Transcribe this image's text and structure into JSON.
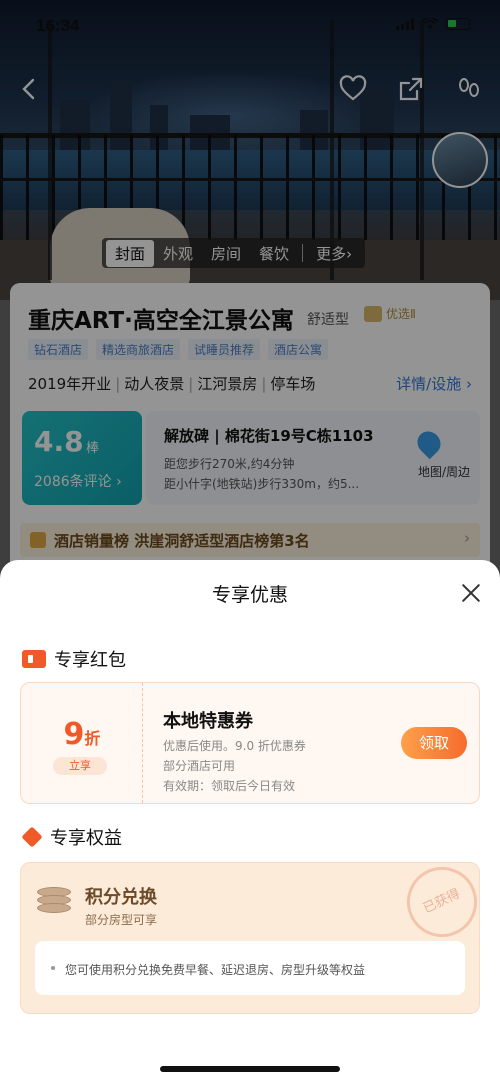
{
  "status_bar": {
    "time": "16:34"
  },
  "hero": {
    "tabs": [
      {
        "label": "封面",
        "active": true
      },
      {
        "label": "外观"
      },
      {
        "label": "房间"
      },
      {
        "label": "餐饮"
      },
      {
        "label": "更多›"
      }
    ],
    "icons": [
      "back-icon",
      "heart-icon",
      "share-icon",
      "footprint-icon"
    ]
  },
  "hotel": {
    "name": "重庆ART·高空全江景公寓",
    "type": "舒适型",
    "badge": "优选Ⅱ",
    "tags": [
      "钻石酒店",
      "精选商旅酒店",
      "试睡员推荐",
      "酒店公寓"
    ],
    "facts": [
      "2019年开业",
      "动人夜景",
      "江河景房",
      "停车场"
    ],
    "detail_link": "详情/设施 ›",
    "rating": {
      "score": "4.8",
      "label": "棒",
      "count": "2086条评论 ›"
    },
    "address": {
      "title": "解放碑 | 棉花街19号C栋1103",
      "line1": "距您步行270米,约4分钟",
      "line2": "距小什字(地铁站)步行330m，约5...",
      "map_label": "地图/周边"
    },
    "ranking": "酒店销量榜 洪崖洞舒适型酒店榜第3名"
  },
  "sheet": {
    "title": "专享优惠",
    "coupon_section": "专享红包",
    "coupon": {
      "discount_value": "9",
      "discount_unit": "折",
      "instant_label": "立享",
      "title": "本地特惠券",
      "line1": "优惠后使用。9.0 折优惠券",
      "line2": "部分酒店可用",
      "line3": "有效期：领取后今日有效",
      "claim_label": "领取"
    },
    "benefit_section": "专享权益",
    "benefit": {
      "title": "积分兑换",
      "subtitle": "部分房型可享",
      "stamp": "已获得",
      "note": "您可使用积分兑换免费早餐、延迟退房、房型升级等权益"
    }
  },
  "colors": {
    "accent": "#f05a28",
    "rating": "#1fb5c0",
    "link": "#2f78d8"
  }
}
